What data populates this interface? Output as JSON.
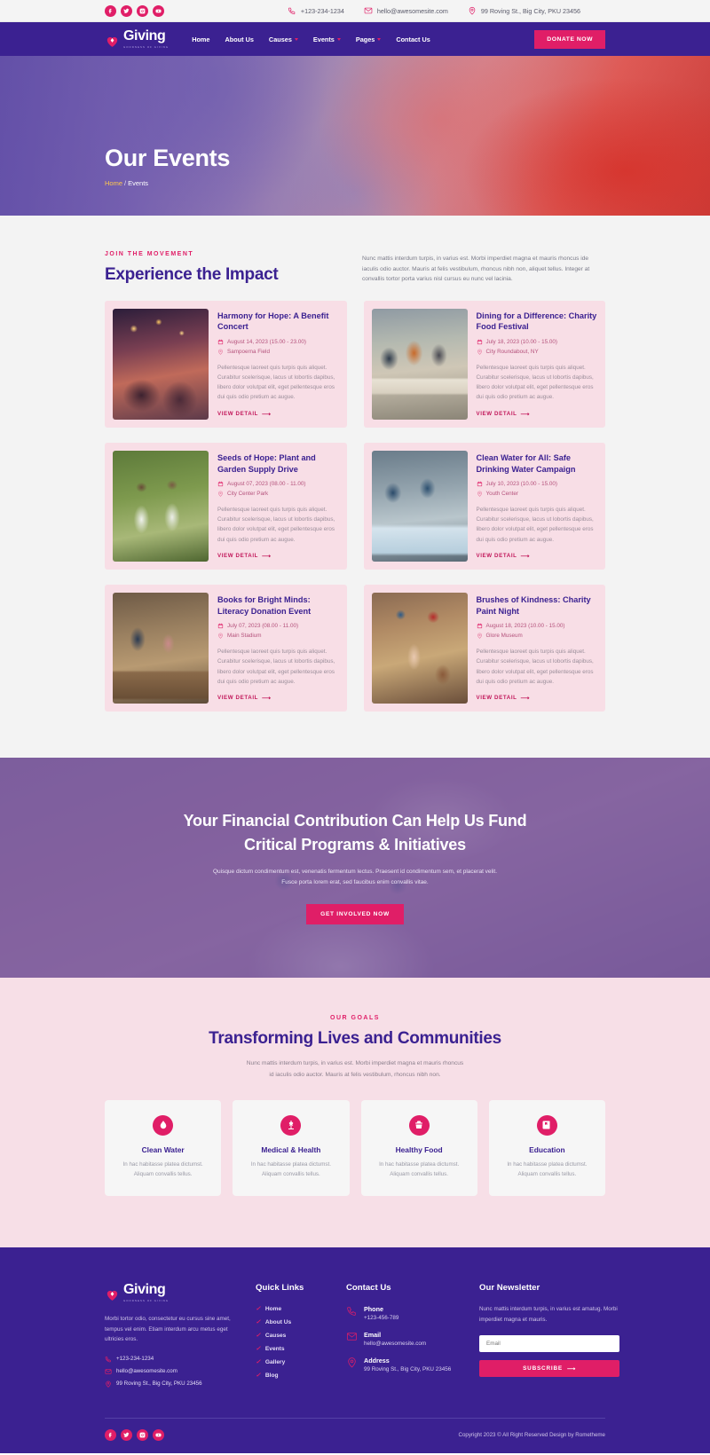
{
  "topbar": {
    "social": [
      {
        "name": "facebook-icon",
        "label": "Facebook"
      },
      {
        "name": "twitter-icon",
        "label": "Twitter"
      },
      {
        "name": "instagram-icon",
        "label": "Instagram"
      },
      {
        "name": "youtube-icon",
        "label": "YouTube"
      }
    ],
    "phone": "+123-234-1234",
    "email": "hello@awesomesite.com",
    "address": "99 Roving St., Big City, PKU 23456"
  },
  "header": {
    "brand": "Giving",
    "brand_sub": "GOODNESS OF GIVING",
    "nav": [
      {
        "label": "Home",
        "dropdown": false
      },
      {
        "label": "About Us",
        "dropdown": false
      },
      {
        "label": "Causes",
        "dropdown": true
      },
      {
        "label": "Events",
        "dropdown": true
      },
      {
        "label": "Pages",
        "dropdown": true
      },
      {
        "label": "Contact Us",
        "dropdown": false
      }
    ],
    "donate_label": "DONATE NOW"
  },
  "hero": {
    "title": "Our Events",
    "breadcrumb_home": "Home",
    "breadcrumb_sep": "/",
    "breadcrumb_current": "Events"
  },
  "events": {
    "eyebrow": "JOIN THE MOVEMENT",
    "title": "Experience the Impact",
    "description": "Nunc mattis interdum turpis, in varius est. Morbi imperdiet magna et mauris rhoncus ide iaculis odio auctor. Mauris at felis vestibulum, rhoncus nibh non, aliquet tellus. Integer at convallis tortor porta varius nisl cursus eu nunc vel lacinia.",
    "link_label": "VIEW DETAIL",
    "body_text": "Pellentesque laoreet quis turpis quis aliquet. Curabitur scelerisque, lacus ut lobortis dapibus, libero dolor volutpat elit, eget pellentesque eros dui quis odio pretium ac augue.",
    "items": [
      {
        "title": "Harmony for Hope: A Benefit Concert",
        "date": "August 14, 2023 (15.00 - 23.00)",
        "location": "Sampoerna Field",
        "thumb": "th1"
      },
      {
        "title": "Dining for a Difference: Charity Food Festival",
        "date": "July 18, 2023 (10.00 - 15.00)",
        "location": "City Roundabout, NY",
        "thumb": "th2"
      },
      {
        "title": "Seeds of Hope: Plant and Garden Supply Drive",
        "date": "August 07, 2023 (08.00 - 11.00)",
        "location": "City Center Park",
        "thumb": "th3"
      },
      {
        "title": "Clean Water for All: Safe Drinking Water Campaign",
        "date": "July 10, 2023 (10.00 - 15.00)",
        "location": "Youth Center",
        "thumb": "th4"
      },
      {
        "title": "Books for Bright Minds: Literacy Donation Event",
        "date": "July 07, 2023 (08.00 - 11.00)",
        "location": "Main Stadium",
        "thumb": "th5"
      },
      {
        "title": "Brushes of Kindness: Charity Paint Night",
        "date": "August 18, 2023 (10.00 - 15.00)",
        "location": "Glore Museum",
        "thumb": "th6"
      }
    ]
  },
  "cta": {
    "title_line1": "Your Financial Contribution Can Help Us Fund",
    "title_line2": "Critical Programs & Initiatives",
    "desc_line1": "Quisque dictum condimentum est, venenatis fermentum lectus. Praesent id condimentum sem, et placerat velit.",
    "desc_line2": "Fusce porta lorem erat, sed faucibus enim convallis vitae.",
    "button": "GET INVOLVED NOW"
  },
  "goals": {
    "eyebrow": "OUR GOALS",
    "title": "Transforming Lives and Communities",
    "desc_line1": "Nunc mattis interdum turpis, in varius est. Morbi imperdiet magna et mauris rhoncus",
    "desc_line2": "id iaculis odio auctor. Mauris at felis vestibulum, rhoncus nibh non.",
    "cards": [
      {
        "icon": "water-drop-icon",
        "name": "Clean Water",
        "text": "In hac habitasse platea dictumst. Aliquam convallis tellus."
      },
      {
        "icon": "medical-caduceus-icon",
        "name": "Medical & Health",
        "text": "In hac habitasse platea dictumst. Aliquam convallis tellus."
      },
      {
        "icon": "food-basket-icon",
        "name": "Healthy Food",
        "text": "In hac habitasse platea dictumst. Aliquam convallis tellus."
      },
      {
        "icon": "book-education-icon",
        "name": "Education",
        "text": "In hac habitasse platea dictumst. Aliquam convallis tellus."
      }
    ]
  },
  "footer": {
    "brand": "Giving",
    "brand_sub": "GOODNESS OF GIVING",
    "about": "Morbi tortor odio, consectetur eu cursus sine amet, tempus vel enim. Etiam interdum arcu metus eget ultricies eros.",
    "contacts": [
      {
        "icon": "phone-icon",
        "text": "+123-234-1234"
      },
      {
        "icon": "mail-icon",
        "text": "hello@awesomesite.com"
      },
      {
        "icon": "location-icon",
        "text": "99 Roving St., Big City, PKU 23456"
      }
    ],
    "quick_links_head": "Quick Links",
    "quick_links": [
      "Home",
      "About Us",
      "Causes",
      "Events",
      "Gallery",
      "Blog"
    ],
    "contact_head": "Contact Us",
    "contact_items": [
      {
        "icon": "phone-icon",
        "label": "Phone",
        "value": "+123-456-789"
      },
      {
        "icon": "mail-icon",
        "label": "Email",
        "value": "hello@awesomesite.com"
      },
      {
        "icon": "location-icon",
        "label": "Address",
        "value": "99 Roving St., Big City, PKU 23456"
      }
    ],
    "newsletter_head": "Our Newsletter",
    "newsletter_desc": "Nunc mattis interdum turpis, in varius est amatug. Morbi imperdiet magna et mauris.",
    "newsletter_placeholder": "Email",
    "subscribe_label": "SUBSCRIBE",
    "social": [
      {
        "name": "facebook-icon"
      },
      {
        "name": "twitter-icon"
      },
      {
        "name": "instagram-icon"
      },
      {
        "name": "youtube-icon"
      }
    ],
    "copyright": "Copyright 2023 © All Right Reserved Design by Rometheme"
  },
  "colors": {
    "primary_purple": "#3b2191",
    "accent_pink": "#e01e67",
    "card_pink": "#f8dee6",
    "section_grey": "#f3f3f3",
    "goals_pink": "#f7dfe7"
  }
}
